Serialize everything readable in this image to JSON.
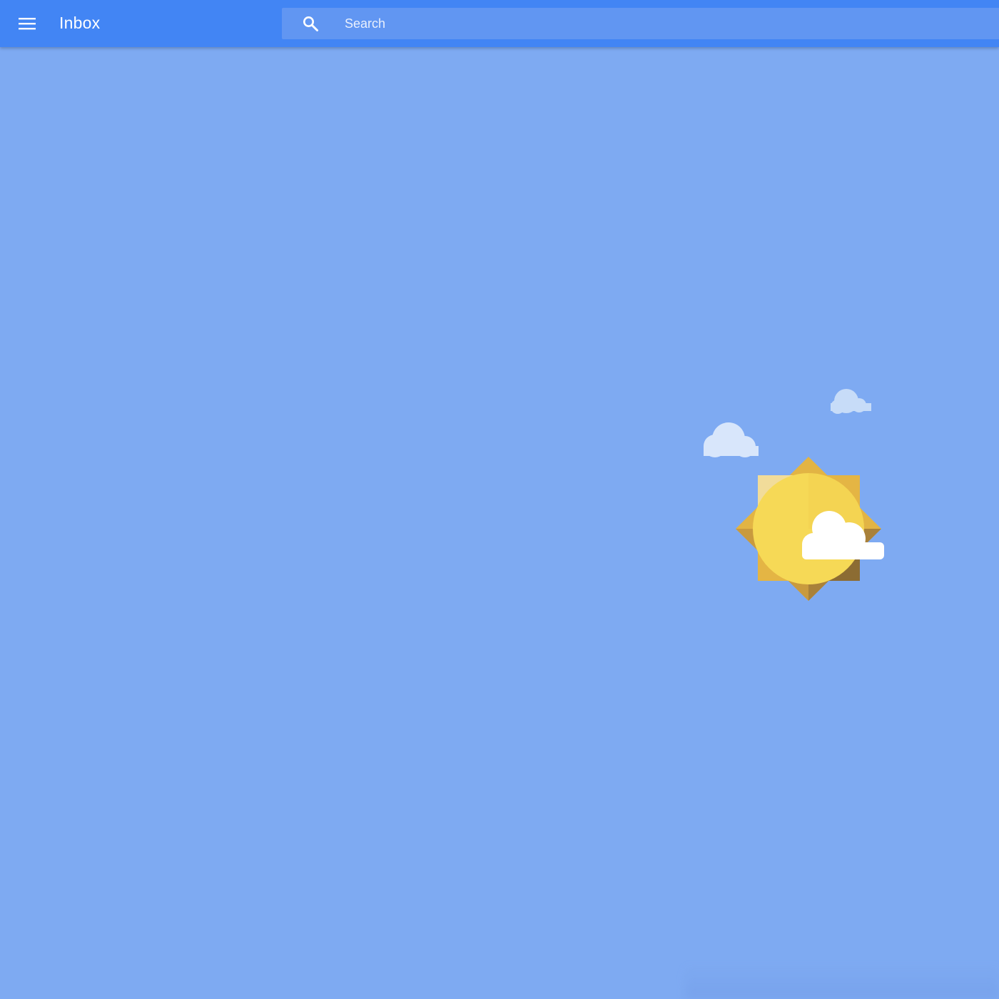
{
  "header": {
    "menu_icon": "menu-icon",
    "title": "Inbox",
    "search": {
      "icon": "search-icon",
      "placeholder": "Search",
      "value": ""
    }
  },
  "main": {
    "illustration": "sun-with-clouds-illustration",
    "background_color": "#7eaaf2"
  },
  "colors": {
    "header": "#4285f4",
    "search_box": "#6196f2",
    "sun": "#f6d956",
    "sun_rays": "#e2b444"
  }
}
